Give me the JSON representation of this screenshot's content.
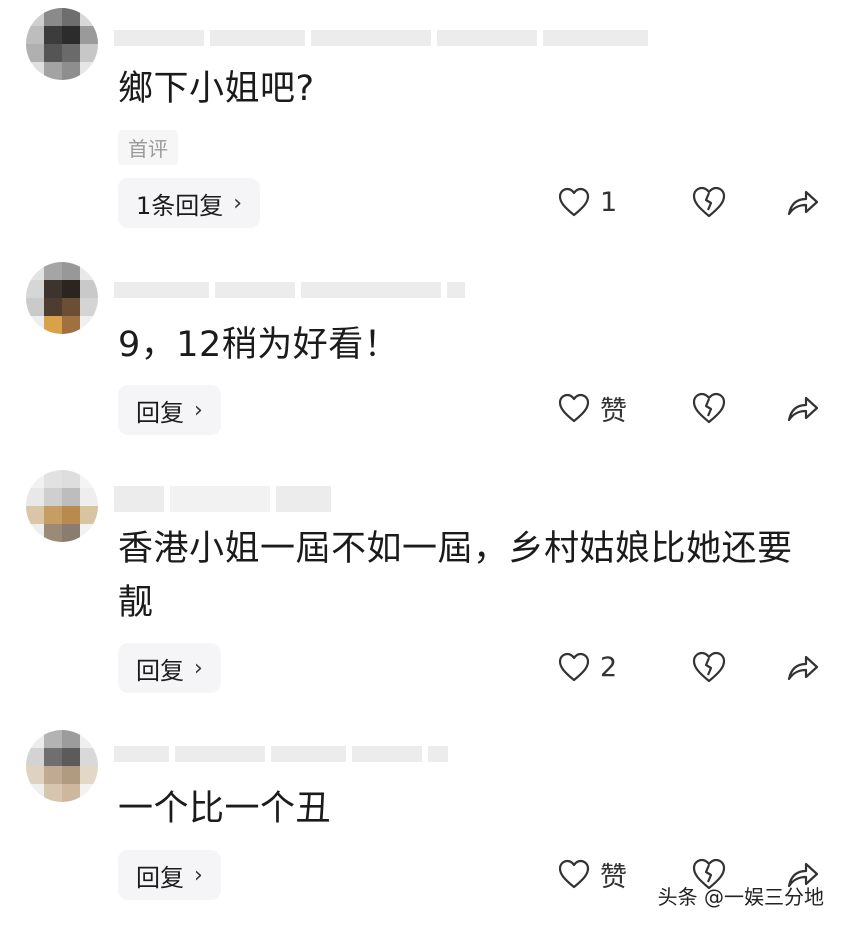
{
  "comments": [
    {
      "text": "鄉下小姐吧?",
      "tag": "首评",
      "reply_label": "1条回复",
      "like_label": "1"
    },
    {
      "text": "9，12稍为好看！",
      "reply_label": "回复",
      "like_label": "赞"
    },
    {
      "text": "香港小姐一屆不如一屆，乡村姑娘比她还要\n靓",
      "reply_label": "回复",
      "like_label": "2"
    },
    {
      "text": "一个比一个丑",
      "reply_label": "回复",
      "like_label": "赞"
    }
  ],
  "reply_chevron": "›",
  "watermark": "头条 @一娱三分地",
  "icons": {
    "like": "heart-outline-icon",
    "dislike": "broken-heart-icon",
    "share": "share-arrow-icon"
  }
}
